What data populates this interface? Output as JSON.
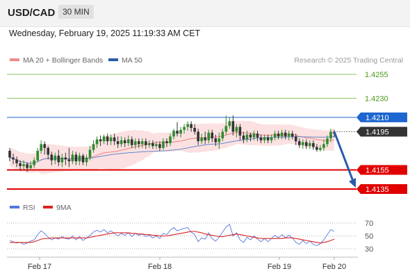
{
  "header": {
    "pair": "USD/CAD",
    "timeframe": "30 MIN"
  },
  "date_line": "Wednesday, February 19, 2025 11:19:33 AM CET",
  "legend": {
    "ma20_label": "MA 20 + Bollinger Bands",
    "ma50_label": "MA 50",
    "copyright": "Research © 2025 Trading Central"
  },
  "colors": {
    "resistance": "#1e66d0",
    "support": "#e00000",
    "target": "#5aa71e",
    "current": "#333333",
    "arrow": "#2a5bab",
    "candle_up": "#2e8b2e",
    "candle_down": "#333333",
    "bollinger": "#f7c8c8",
    "ma20": "#ef8080",
    "ma50": "#6688cc",
    "rsi": "#5577dd",
    "rsi_ma": "#dd2222"
  },
  "chart_data": [
    {
      "type": "candlestick",
      "x_labels": [
        "Feb 17",
        "Feb 18",
        "Feb 19",
        "Feb 20"
      ],
      "ylim": [
        1.413,
        1.4265
      ],
      "levels": [
        {
          "value": 1.4255,
          "label": "1.4255",
          "kind": "target"
        },
        {
          "value": 1.423,
          "label": "1.4230",
          "kind": "target"
        },
        {
          "value": 1.421,
          "label": "1.4210",
          "kind": "resistance"
        },
        {
          "value": 1.4195,
          "label": "1.4195",
          "kind": "current"
        },
        {
          "value": 1.4155,
          "label": "1.4155",
          "kind": "support"
        },
        {
          "value": 1.4135,
          "label": "1.4135",
          "kind": "support"
        }
      ],
      "forecast_arrow": {
        "from": 1.4195,
        "to": 1.4135
      },
      "candles": [
        [
          1.4175,
          1.4168,
          1.4178,
          1.4164
        ],
        [
          1.4168,
          1.4166,
          1.4172,
          1.4161
        ],
        [
          1.4166,
          1.4162,
          1.4169,
          1.4158
        ],
        [
          1.4162,
          1.4159,
          1.4165,
          1.4154
        ],
        [
          1.4159,
          1.4161,
          1.4165,
          1.4155
        ],
        [
          1.4161,
          1.4157,
          1.4163,
          1.4153
        ],
        [
          1.4157,
          1.416,
          1.4164,
          1.4155
        ],
        [
          1.416,
          1.4165,
          1.4168,
          1.4157
        ],
        [
          1.4165,
          1.4175,
          1.4178,
          1.4163
        ],
        [
          1.4175,
          1.4182,
          1.4186,
          1.4172
        ],
        [
          1.4182,
          1.4178,
          1.4185,
          1.4171
        ],
        [
          1.4178,
          1.4171,
          1.418,
          1.4166
        ],
        [
          1.4171,
          1.4165,
          1.4174,
          1.416
        ],
        [
          1.4165,
          1.417,
          1.4173,
          1.4161
        ],
        [
          1.417,
          1.4163,
          1.4176,
          1.4159
        ],
        [
          1.4163,
          1.4168,
          1.4172,
          1.4158
        ],
        [
          1.4168,
          1.4166,
          1.4173,
          1.416
        ],
        [
          1.4166,
          1.4164,
          1.4178,
          1.4158
        ],
        [
          1.4164,
          1.4171,
          1.4175,
          1.4161
        ],
        [
          1.4171,
          1.4164,
          1.4174,
          1.416
        ],
        [
          1.4164,
          1.417,
          1.4173,
          1.416
        ],
        [
          1.417,
          1.4163,
          1.4172,
          1.416
        ],
        [
          1.4163,
          1.4168,
          1.4171,
          1.4159
        ],
        [
          1.4168,
          1.4176,
          1.418,
          1.4165
        ],
        [
          1.4176,
          1.4182,
          1.4186,
          1.4173
        ],
        [
          1.4182,
          1.4187,
          1.419,
          1.4178
        ],
        [
          1.4187,
          1.4185,
          1.4191,
          1.418
        ],
        [
          1.4185,
          1.419,
          1.4192,
          1.4182
        ],
        [
          1.419,
          1.4185,
          1.4193,
          1.4181
        ],
        [
          1.4185,
          1.4189,
          1.4192,
          1.4181
        ],
        [
          1.4189,
          1.4185,
          1.4193,
          1.4181
        ],
        [
          1.4185,
          1.4182,
          1.419,
          1.4178
        ],
        [
          1.4182,
          1.4186,
          1.419,
          1.4179
        ],
        [
          1.4186,
          1.4183,
          1.4189,
          1.4179
        ],
        [
          1.4183,
          1.4187,
          1.4191,
          1.418
        ],
        [
          1.4187,
          1.4181,
          1.419,
          1.4178
        ],
        [
          1.4181,
          1.4185,
          1.4188,
          1.4177
        ],
        [
          1.4185,
          1.4182,
          1.4188,
          1.4178
        ],
        [
          1.4182,
          1.4185,
          1.4188,
          1.4178
        ],
        [
          1.4185,
          1.4181,
          1.4188,
          1.4177
        ],
        [
          1.4181,
          1.4183,
          1.4186,
          1.4178
        ],
        [
          1.4183,
          1.418,
          1.4186,
          1.4177
        ],
        [
          1.418,
          1.4182,
          1.4185,
          1.4177
        ],
        [
          1.4182,
          1.4178,
          1.4185,
          1.4175
        ],
        [
          1.4178,
          1.4185,
          1.4188,
          1.4176
        ],
        [
          1.4185,
          1.4183,
          1.4188,
          1.4179
        ],
        [
          1.4183,
          1.419,
          1.4193,
          1.418
        ],
        [
          1.419,
          1.4196,
          1.4198,
          1.4187
        ],
        [
          1.4196,
          1.4193,
          1.4205,
          1.419
        ],
        [
          1.4193,
          1.4197,
          1.42,
          1.4189
        ],
        [
          1.4197,
          1.42,
          1.4203,
          1.4193
        ],
        [
          1.42,
          1.4203,
          1.4206,
          1.4196
        ],
        [
          1.4203,
          1.4199,
          1.4206,
          1.4195
        ],
        [
          1.4199,
          1.4195,
          1.4203,
          1.4192
        ],
        [
          1.4195,
          1.4185,
          1.4198,
          1.4181
        ],
        [
          1.4185,
          1.4189,
          1.4193,
          1.4182
        ],
        [
          1.4189,
          1.4186,
          1.4195,
          1.4182
        ],
        [
          1.4186,
          1.4194,
          1.4197,
          1.4183
        ],
        [
          1.4194,
          1.4188,
          1.4197,
          1.4184
        ],
        [
          1.4188,
          1.4184,
          1.4192,
          1.418
        ],
        [
          1.4184,
          1.4188,
          1.4194,
          1.4177
        ],
        [
          1.4188,
          1.4195,
          1.4198,
          1.4185
        ],
        [
          1.4195,
          1.4201,
          1.4212,
          1.4192
        ],
        [
          1.4201,
          1.4206,
          1.421,
          1.4198
        ],
        [
          1.4206,
          1.4195,
          1.4212,
          1.4191
        ],
        [
          1.4195,
          1.42,
          1.4203,
          1.4189
        ],
        [
          1.42,
          1.4191,
          1.4203,
          1.4186
        ],
        [
          1.4191,
          1.4187,
          1.4195,
          1.4183
        ],
        [
          1.4187,
          1.4192,
          1.4196,
          1.4184
        ],
        [
          1.4192,
          1.4189,
          1.4194,
          1.4185
        ],
        [
          1.4189,
          1.4193,
          1.4196,
          1.4186
        ],
        [
          1.4193,
          1.4189,
          1.4196,
          1.4185
        ],
        [
          1.4189,
          1.4186,
          1.4192,
          1.4183
        ],
        [
          1.4186,
          1.4189,
          1.4192,
          1.4183
        ],
        [
          1.4189,
          1.4186,
          1.4192,
          1.4183
        ],
        [
          1.4186,
          1.4189,
          1.4192,
          1.4183
        ],
        [
          1.4189,
          1.4193,
          1.4196,
          1.4186
        ],
        [
          1.4193,
          1.419,
          1.4196,
          1.4187
        ],
        [
          1.419,
          1.4194,
          1.4197,
          1.4187
        ],
        [
          1.4194,
          1.419,
          1.4197,
          1.4187
        ],
        [
          1.419,
          1.4193,
          1.4196,
          1.4186
        ],
        [
          1.4193,
          1.419,
          1.4196,
          1.4187
        ],
        [
          1.419,
          1.4185,
          1.4193,
          1.4181
        ],
        [
          1.4185,
          1.4181,
          1.4188,
          1.4178
        ],
        [
          1.4181,
          1.4184,
          1.4187,
          1.4177
        ],
        [
          1.4184,
          1.418,
          1.4187,
          1.4177
        ],
        [
          1.418,
          1.4183,
          1.4186,
          1.4177
        ],
        [
          1.4183,
          1.4179,
          1.4186,
          1.4176
        ],
        [
          1.4179,
          1.4176,
          1.4182,
          1.4174
        ],
        [
          1.4176,
          1.4178,
          1.4181,
          1.4174
        ],
        [
          1.4178,
          1.4182,
          1.4187,
          1.4175
        ],
        [
          1.4182,
          1.4188,
          1.4191,
          1.4179
        ],
        [
          1.4188,
          1.4195,
          1.4198,
          1.4184
        ],
        [
          1.4195,
          1.4193,
          1.4197,
          1.4189
        ]
      ]
    },
    {
      "type": "line",
      "title": "RSI",
      "legend": [
        "RSI",
        "9MA"
      ],
      "y_ticks": [
        70,
        50,
        30
      ],
      "ylim": [
        20,
        80
      ],
      "rsi": [
        43,
        41,
        39,
        40,
        37,
        39,
        42,
        44,
        52,
        58,
        54,
        48,
        44,
        47,
        45,
        49,
        46,
        45,
        50,
        44,
        49,
        43,
        47,
        51,
        56,
        59,
        56,
        60,
        55,
        58,
        54,
        50,
        54,
        51,
        55,
        49,
        54,
        51,
        53,
        49,
        51,
        47,
        50,
        46,
        54,
        52,
        59,
        63,
        58,
        60,
        62,
        63,
        56,
        52,
        41,
        47,
        45,
        55,
        46,
        42,
        48,
        56,
        64,
        68,
        50,
        55,
        44,
        40,
        48,
        44,
        50,
        45,
        41,
        46,
        41,
        46,
        51,
        47,
        52,
        47,
        51,
        47,
        40,
        37,
        43,
        38,
        42,
        37,
        35,
        38,
        44,
        52,
        60,
        57
      ],
      "rsi_ma": [
        40,
        40,
        40,
        40,
        40,
        40,
        40,
        41,
        43,
        45,
        46,
        46,
        47,
        47,
        47,
        47,
        47,
        47,
        47,
        47,
        47,
        47,
        47,
        48,
        49,
        50,
        51,
        52,
        53,
        54,
        55,
        55,
        55,
        55,
        55,
        54,
        54,
        53,
        53,
        52,
        52,
        51,
        51,
        50,
        50,
        50,
        51,
        52,
        53,
        54,
        55,
        56,
        57,
        57,
        56,
        55,
        53,
        52,
        51,
        50,
        49,
        49,
        50,
        51,
        52,
        53,
        52,
        51,
        50,
        49,
        48,
        47,
        46,
        46,
        46,
        46,
        46,
        46,
        46,
        47,
        47,
        47,
        46,
        45,
        44,
        43,
        42,
        41,
        40,
        39,
        40,
        41,
        43,
        45
      ]
    }
  ]
}
